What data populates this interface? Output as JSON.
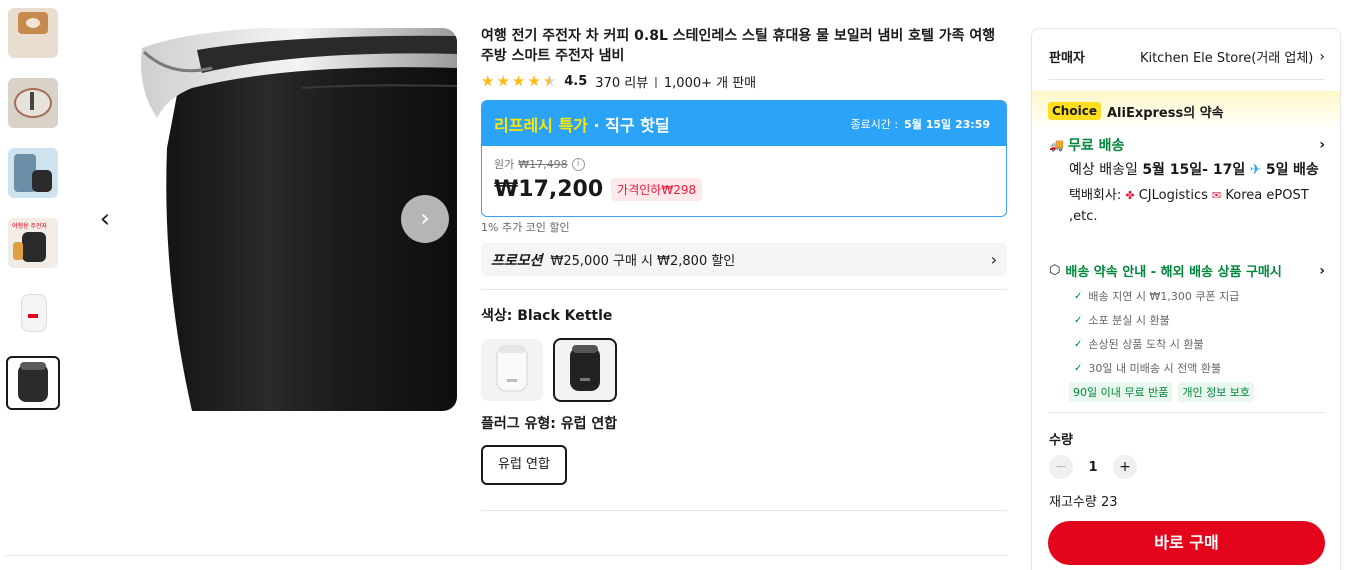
{
  "gallery": {
    "thumbnails": [
      {
        "name": "thumb-1"
      },
      {
        "name": "thumb-2"
      },
      {
        "name": "thumb-3"
      },
      {
        "name": "thumb-4",
        "overlay_text": "여행용 주전자"
      },
      {
        "name": "thumb-5"
      },
      {
        "name": "thumb-6",
        "active": true
      }
    ],
    "prev_icon": "chevron-left-icon",
    "next_icon": "chevron-right-icon"
  },
  "product": {
    "title": "여행 전기 주전자 차 커피 0.8L 스테인레스 스틸 휴대용 물 보일러 냄비 호텔 가족 여행 주방 스마트 주전자 냄비",
    "rating": "4.5",
    "rating_stars": 4.5,
    "reviews": "370 리뷰",
    "sales": "1,000+ 개 판매"
  },
  "deal": {
    "name": "리프레시 특가",
    "subtitle": "· 직구 핫딜",
    "end_label": "종료시간 :",
    "end_time": "5월 15일 23:59",
    "original_label": "원가",
    "original_price": "₩17,498",
    "price": "₩17,200",
    "discount": "가격인하₩298"
  },
  "coin_note": "1% 추가 코인 할인",
  "promotion": {
    "tag": "프로모션",
    "text": "₩25,000 구매 시 ₩2,800 할인"
  },
  "color": {
    "label": "색상: Black Kettle",
    "options": [
      "White Kettle",
      "Black Kettle"
    ],
    "selected": "Black Kettle"
  },
  "plug": {
    "label": "플러그 유형: 유럽 연합",
    "option": "유럽 연합"
  },
  "seller": {
    "label": "판매자",
    "name": "Kitchen Ele Store(거래 업체)"
  },
  "choice": {
    "badge": "Choice",
    "promise": "AliExpress의 약속"
  },
  "shipping": {
    "title": "무료 배송",
    "estimate_prefix": "예상 배송일",
    "estimate_dates": "5월 15일- 17일",
    "estimate_days": "5일",
    "estimate_suffix": "배송",
    "courier_label": "택배회사:",
    "courier_1": "CJLogistics",
    "courier_2": "Korea ePOST ,etc."
  },
  "assurance": {
    "title": "배송 약속 안내 - 해외 배송 상품 구매시",
    "items": [
      "배송 지연 시 ₩1,300 쿠폰 지급",
      "소포 분실 시 환불",
      "손상된 상품 도착 시 환불",
      "30일 내 미배송 시 전액 환불"
    ],
    "tags": [
      "90일 이내 무료 반품",
      "개인 정보 보호"
    ]
  },
  "quantity": {
    "label": "수량",
    "value": "1",
    "stock": "재고수량 23"
  },
  "buy_button": "바로 구매",
  "colors": {
    "accent_red": "#e3051b",
    "deal_blue": "#2ba3f6",
    "deal_yellow": "#ffe600",
    "green": "#00873c",
    "star": "#fdbd13",
    "choice_yellow": "#ffde21"
  }
}
